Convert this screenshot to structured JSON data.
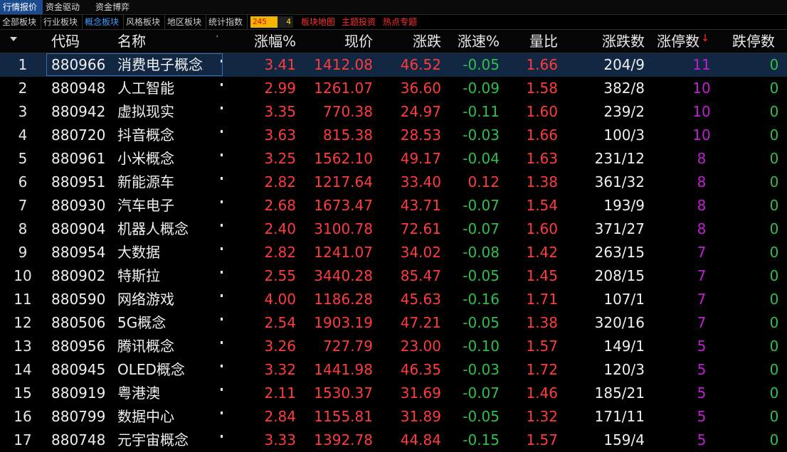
{
  "top_tabs": [
    "行情报价",
    "资金驱动力",
    "资金博弈"
  ],
  "sub_tabs": [
    "全部板块",
    "行业板块",
    "概念板块",
    "风格板块",
    "地区板块",
    "统计指数"
  ],
  "badge": {
    "left": "245",
    "right": "4"
  },
  "red_links": [
    "板块地图",
    "主题投资",
    "热点专题"
  ],
  "columns": [
    "代码",
    "名称",
    "涨幅%",
    "现价",
    "涨跌",
    "涨速%",
    "量比",
    "涨跌数",
    "涨停数",
    "跌停数"
  ],
  "sort_indicator": "↓",
  "rows": [
    {
      "idx": "1",
      "code": "880966",
      "name": "消费电子概念",
      "chg_pct": "3.41",
      "price": "1412.08",
      "chg": "46.52",
      "speed": "-0.05",
      "vol_ratio": "1.66",
      "adv_dec": "204/9",
      "limit_up": "11",
      "limit_down": "0"
    },
    {
      "idx": "2",
      "code": "880948",
      "name": "人工智能",
      "chg_pct": "2.99",
      "price": "1261.07",
      "chg": "36.60",
      "speed": "-0.09",
      "vol_ratio": "1.58",
      "adv_dec": "382/8",
      "limit_up": "10",
      "limit_down": "0"
    },
    {
      "idx": "3",
      "code": "880942",
      "name": "虚拟现实",
      "chg_pct": "3.35",
      "price": "770.38",
      "chg": "24.97",
      "speed": "-0.11",
      "vol_ratio": "1.60",
      "adv_dec": "239/2",
      "limit_up": "10",
      "limit_down": "0"
    },
    {
      "idx": "4",
      "code": "880720",
      "name": "抖音概念",
      "chg_pct": "3.63",
      "price": "815.38",
      "chg": "28.53",
      "speed": "-0.03",
      "vol_ratio": "1.66",
      "adv_dec": "100/3",
      "limit_up": "10",
      "limit_down": "0"
    },
    {
      "idx": "5",
      "code": "880961",
      "name": "小米概念",
      "chg_pct": "3.25",
      "price": "1562.10",
      "chg": "49.17",
      "speed": "-0.04",
      "vol_ratio": "1.63",
      "adv_dec": "231/12",
      "limit_up": "8",
      "limit_down": "0"
    },
    {
      "idx": "6",
      "code": "880951",
      "name": "新能源车",
      "chg_pct": "2.82",
      "price": "1217.64",
      "chg": "33.40",
      "speed": "0.12",
      "vol_ratio": "1.38",
      "adv_dec": "361/32",
      "limit_up": "8",
      "limit_down": "0"
    },
    {
      "idx": "7",
      "code": "880930",
      "name": "汽车电子",
      "chg_pct": "2.68",
      "price": "1673.47",
      "chg": "43.71",
      "speed": "-0.07",
      "vol_ratio": "1.54",
      "adv_dec": "193/9",
      "limit_up": "8",
      "limit_down": "0"
    },
    {
      "idx": "8",
      "code": "880904",
      "name": "机器人概念",
      "chg_pct": "2.40",
      "price": "3100.78",
      "chg": "72.61",
      "speed": "-0.07",
      "vol_ratio": "1.60",
      "adv_dec": "371/27",
      "limit_up": "8",
      "limit_down": "0"
    },
    {
      "idx": "9",
      "code": "880954",
      "name": "大数据",
      "chg_pct": "2.82",
      "price": "1241.07",
      "chg": "34.02",
      "speed": "-0.08",
      "vol_ratio": "1.42",
      "adv_dec": "263/15",
      "limit_up": "7",
      "limit_down": "0"
    },
    {
      "idx": "10",
      "code": "880902",
      "name": "特斯拉",
      "chg_pct": "2.55",
      "price": "3440.28",
      "chg": "85.47",
      "speed": "-0.05",
      "vol_ratio": "1.45",
      "adv_dec": "208/15",
      "limit_up": "7",
      "limit_down": "0"
    },
    {
      "idx": "11",
      "code": "880590",
      "name": "网络游戏",
      "chg_pct": "4.00",
      "price": "1186.28",
      "chg": "45.63",
      "speed": "-0.16",
      "vol_ratio": "1.71",
      "adv_dec": "107/1",
      "limit_up": "7",
      "limit_down": "0"
    },
    {
      "idx": "12",
      "code": "880506",
      "name": "5G概念",
      "chg_pct": "2.54",
      "price": "1903.19",
      "chg": "47.21",
      "speed": "-0.05",
      "vol_ratio": "1.38",
      "adv_dec": "320/16",
      "limit_up": "7",
      "limit_down": "0"
    },
    {
      "idx": "13",
      "code": "880956",
      "name": "腾讯概念",
      "chg_pct": "3.26",
      "price": "727.79",
      "chg": "23.00",
      "speed": "-0.10",
      "vol_ratio": "1.57",
      "adv_dec": "149/1",
      "limit_up": "5",
      "limit_down": "0"
    },
    {
      "idx": "14",
      "code": "880945",
      "name": "OLED概念",
      "chg_pct": "3.32",
      "price": "1441.98",
      "chg": "46.35",
      "speed": "-0.03",
      "vol_ratio": "1.72",
      "adv_dec": "120/3",
      "limit_up": "5",
      "limit_down": "0"
    },
    {
      "idx": "15",
      "code": "880919",
      "name": "粤港澳",
      "chg_pct": "2.11",
      "price": "1530.37",
      "chg": "31.69",
      "speed": "-0.07",
      "vol_ratio": "1.46",
      "adv_dec": "185/21",
      "limit_up": "5",
      "limit_down": "0"
    },
    {
      "idx": "16",
      "code": "880799",
      "name": "数据中心",
      "chg_pct": "2.84",
      "price": "1155.81",
      "chg": "31.89",
      "speed": "-0.05",
      "vol_ratio": "1.32",
      "adv_dec": "171/11",
      "limit_up": "5",
      "limit_down": "0"
    },
    {
      "idx": "17",
      "code": "880748",
      "name": "元宇宙概念",
      "chg_pct": "3.33",
      "price": "1392.78",
      "chg": "44.84",
      "speed": "-0.15",
      "vol_ratio": "1.57",
      "adv_dec": "159/4",
      "limit_up": "5",
      "limit_down": "0"
    }
  ],
  "colors": {
    "up": "#ff3b3b",
    "down": "#2fbf4a",
    "limit_up": "#c01fd1",
    "selected_row": "#122742",
    "accent_tab": "#1b4b8f"
  }
}
